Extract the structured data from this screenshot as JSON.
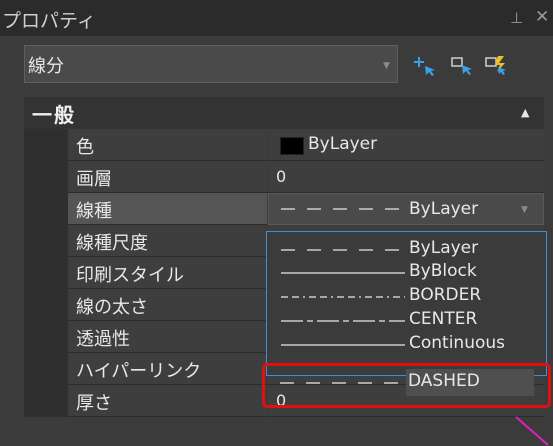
{
  "panel": {
    "title": "プロパティ"
  },
  "selector": {
    "value": "線分"
  },
  "toolbar": [
    {
      "name": "add-to-selection-icon"
    },
    {
      "name": "select-objects-icon"
    },
    {
      "name": "quick-select-icon"
    }
  ],
  "category": {
    "label": "一般"
  },
  "rows": [
    {
      "label": "色",
      "value": "ByLayer",
      "swatch_color": "#000000"
    },
    {
      "label": "画層",
      "value": "0"
    },
    {
      "label": "線種",
      "value": "ByLayer"
    },
    {
      "label": "線種尺度",
      "value": ""
    },
    {
      "label": "印刷スタイル",
      "value": ""
    },
    {
      "label": "線の太さ",
      "value": ""
    },
    {
      "label": "透過性",
      "value": ""
    },
    {
      "label": "ハイパーリンク",
      "value": ""
    },
    {
      "label": "厚さ",
      "value": "0"
    }
  ],
  "dropdown": {
    "options": [
      {
        "name": "ByLayer",
        "pattern": "dashed"
      },
      {
        "name": "ByBlock",
        "pattern": "solid"
      },
      {
        "name": "BORDER",
        "pattern": "border"
      },
      {
        "name": "CENTER",
        "pattern": "center"
      },
      {
        "name": "Continuous",
        "pattern": "solid"
      },
      {
        "name": "DASHED",
        "pattern": "dashed"
      }
    ],
    "highlighted": "DASHED"
  },
  "colors": {
    "accent": "#3e8ed0",
    "annotation": "#e01010",
    "marker": "#e020c0"
  }
}
